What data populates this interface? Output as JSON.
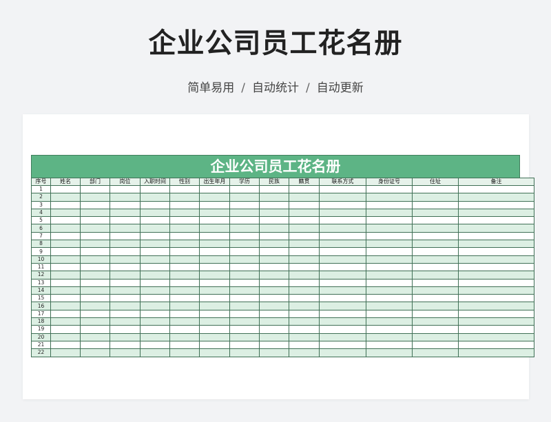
{
  "header": {
    "title": "企业公司员工花名册",
    "subtitle_parts": [
      "简单易用",
      "自动统计",
      "自动更新"
    ],
    "separator": "/"
  },
  "sheet": {
    "title": "企业公司员工花名册",
    "columns": [
      "序号",
      "姓名",
      "部门",
      "岗位",
      "入职时间",
      "性别",
      "出生年月",
      "学历",
      "民族",
      "籍贯",
      "联系方式",
      "身份证号",
      "住址",
      "备注"
    ],
    "row_numbers": [
      "1",
      "2",
      "3",
      "4",
      "5",
      "6",
      "7",
      "8",
      "9",
      "10",
      "11",
      "12",
      "13",
      "14",
      "15",
      "16",
      "17",
      "18",
      "19",
      "20",
      "21",
      "22"
    ]
  },
  "colors": {
    "page_background": "#f2f3f5",
    "title_band": "#5db485",
    "row_band": "#dcefe3",
    "grid_line": "#3f6f55"
  }
}
